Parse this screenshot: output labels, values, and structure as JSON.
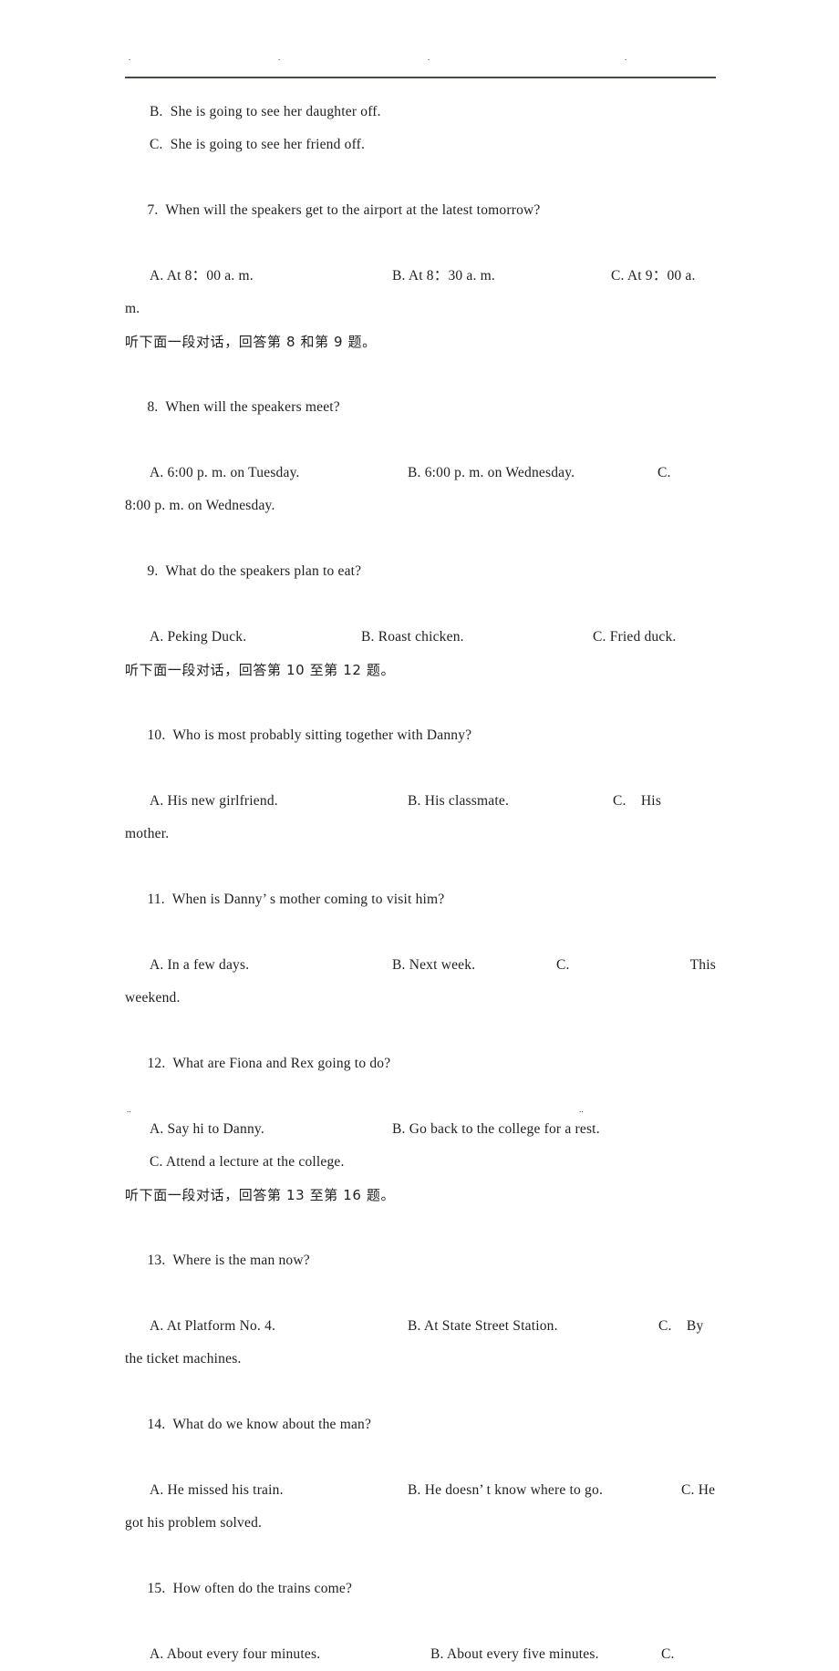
{
  "document": {
    "type": "exam-paper-page",
    "language_mix": "English with Chinese instructions",
    "header": {
      "rule_color": "#3f4f42",
      "tick_marks": [
        ".",
        ".",
        ".",
        "."
      ]
    },
    "footer": {
      "marks": [
        "..",
        ".."
      ]
    }
  },
  "content": {
    "orphan_options": [
      {
        "label": "B.",
        "text": "She is going to see her daughter off."
      },
      {
        "label": "C.",
        "text": "She is going to see her friend off."
      }
    ],
    "questions": [
      {
        "number": "7.",
        "stem": "When will the speakers get to the airport at the latest tomorrow?",
        "option_a": "A. At 8：00 a. m.",
        "option_b": "B. At 8：30 a. m.",
        "option_c": "C. At 9：00 a.",
        "continuation": "m."
      },
      {
        "number": "8.",
        "stem": "When will the speakers meet?",
        "option_a": "A. 6:00 p. m. on Tuesday.",
        "option_b": "B. 6:00 p. m. on Wednesday.",
        "option_c": "C.",
        "continuation": "8:00 p. m. on Wednesday."
      },
      {
        "number": "9.",
        "stem": "What do the speakers plan to eat?",
        "option_a": "A. Peking Duck.",
        "option_b": "B. Roast chicken.",
        "option_c": "C. Fried duck.",
        "continuation": ""
      },
      {
        "number": "10.",
        "stem": "Who is most probably sitting together with Danny?",
        "option_a": "A. His new girlfriend.",
        "option_b": "B. His classmate.",
        "option_c": "C.    His",
        "continuation": "mother."
      },
      {
        "number": "11.",
        "stem": "When is Danny’ s mother coming to visit him?",
        "option_a": "A. In a few days.",
        "option_b": "B. Next week.",
        "option_c": "C.",
        "option_c_tail": "This",
        "continuation": "weekend."
      },
      {
        "number": "12.",
        "stem": "What are Fiona and Rex going to do?",
        "option_a": "A. Say hi to Danny.",
        "option_b": "B. Go back to the college for a rest.",
        "option_c": "C. Attend a lecture at the college.",
        "continuation": ""
      },
      {
        "number": "13.",
        "stem": "Where is the man now?",
        "option_a": "A. At Platform No. 4.",
        "option_b": "B. At State Street Station.",
        "option_c": "C.    By",
        "continuation": "the ticket machines."
      },
      {
        "number": "14.",
        "stem": "What do we know about the man?",
        "option_a": "A. He missed his train.",
        "option_b": "B. He doesn’ t know where to go.",
        "option_c": "C. He",
        "continuation": "got his problem solved."
      },
      {
        "number": "15.",
        "stem": "How often do the trains come?",
        "option_a": "A. About every four minutes.",
        "option_b": "B. About every five minutes.",
        "option_c": "C.",
        "continuation": ""
      }
    ],
    "directions": [
      {
        "id": "dir-8-9",
        "text": "听下面一段对话，回答第 8 和第 9 题。"
      },
      {
        "id": "dir-10-12",
        "text": "听下面一段对话，回答第 10 至第 12 题。"
      },
      {
        "id": "dir-13-16",
        "text": "听下面一段对话，回答第 13 至第 16 题。"
      }
    ]
  }
}
